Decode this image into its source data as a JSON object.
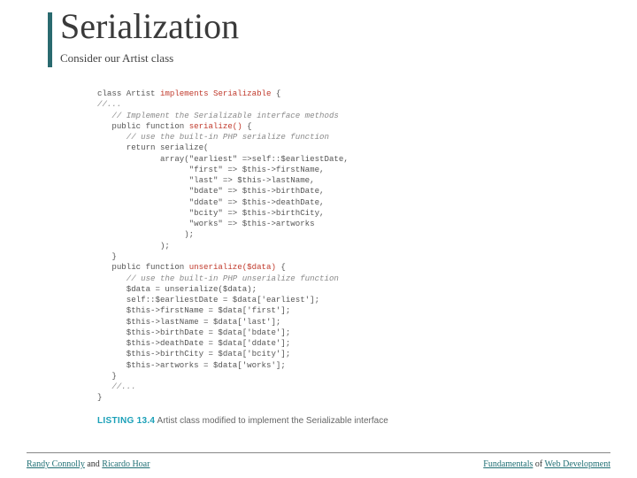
{
  "header": {
    "title": "Serialization",
    "subtitle": "Consider our Artist class"
  },
  "code": {
    "l1a": "class Artist ",
    "l1b": "implements Serializable",
    "l1c": " {",
    "l2": "//...",
    "l3": "   // Implement the Serializable interface methods",
    "l4a": "   public function ",
    "l4b": "serialize()",
    "l4c": " {",
    "l5": "      // use the built-in PHP serialize function",
    "l6": "      return serialize(",
    "l7": "             array(\"earliest\" =>self::$earliestDate,",
    "l8": "                   \"first\" => $this->firstName,",
    "l9": "                   \"last\" => $this->lastName,",
    "l10": "                   \"bdate\" => $this->birthDate,",
    "l11": "                   \"ddate\" => $this->deathDate,",
    "l12": "                   \"bcity\" => $this->birthCity,",
    "l13": "                   \"works\" => $this->artworks",
    "l14": "                  );",
    "l15": "             );",
    "l16": "   }",
    "l17a": "   public function ",
    "l17b": "unserialize($data)",
    "l17c": " {",
    "l18": "      // use the built-in PHP unserialize function",
    "l19": "      $data = unserialize($data);",
    "l20": "      self::$earliestDate = $data['earliest'];",
    "l21": "      $this->firstName = $data['first'];",
    "l22": "      $this->lastName = $data['last'];",
    "l23": "      $this->birthDate = $data['bdate'];",
    "l24": "      $this->deathDate = $data['ddate'];",
    "l25": "      $this->birthCity = $data['bcity'];",
    "l26": "      $this->artworks = $data['works'];",
    "l27": "   }",
    "l28": "   //...",
    "l29": "}"
  },
  "listing": {
    "number": "LISTING 13.4",
    "caption": " Artist class modified to implement the Serializable interface"
  },
  "footer": {
    "author1": "Randy Connolly",
    "and": " and ",
    "author2": "Ricardo Hoar",
    "book1": "Fundamentals",
    "of": " of ",
    "book2": "Web Development"
  }
}
